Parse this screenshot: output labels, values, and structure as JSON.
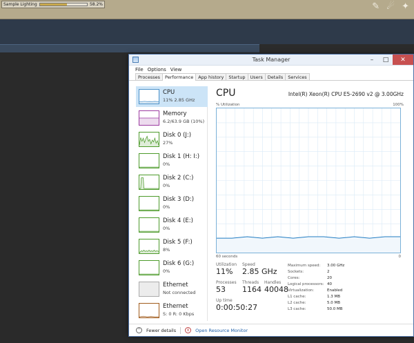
{
  "background": {
    "sample_label": "Sample Lighting",
    "sample_value": "58.2%",
    "sample_fill_fraction": 0.582
  },
  "window": {
    "title": "Task Manager",
    "minimize": "–",
    "maximize": "□",
    "close": "✕"
  },
  "menu": [
    "File",
    "Options",
    "View"
  ],
  "tabs": [
    {
      "label": "Processes"
    },
    {
      "label": "Performance"
    },
    {
      "label": "App history"
    },
    {
      "label": "Startup"
    },
    {
      "label": "Users"
    },
    {
      "label": "Details"
    },
    {
      "label": "Services"
    }
  ],
  "devices": [
    {
      "name": "CPU",
      "value": "11% 2.85 GHz",
      "color": "#4a90c8",
      "selected": true
    },
    {
      "name": "Memory",
      "value": "6.2/63.9 GB (10%)",
      "color": "#9b3aa0"
    },
    {
      "name": "Disk 0 (J:)",
      "value": "27%",
      "color": "#4c9a2a"
    },
    {
      "name": "Disk 1 (H: I:)",
      "value": "0%",
      "color": "#4c9a2a"
    },
    {
      "name": "Disk 2 (C:)",
      "value": "0%",
      "color": "#4c9a2a"
    },
    {
      "name": "Disk 3 (D:)",
      "value": "0%",
      "color": "#4c9a2a"
    },
    {
      "name": "Disk 4 (E:)",
      "value": "0%",
      "color": "#4c9a2a"
    },
    {
      "name": "Disk 5 (F:)",
      "value": "8%",
      "color": "#4c9a2a"
    },
    {
      "name": "Disk 6 (G:)",
      "value": "0%",
      "color": "#4c9a2a"
    },
    {
      "name": "Ethernet",
      "value": "Not connected",
      "color": "#aaaaaa"
    },
    {
      "name": "Ethernet",
      "value": "S: 0 R: 0 Kbps",
      "color": "#a05a1a"
    }
  ],
  "main": {
    "title": "CPU",
    "model": "Intel(R) Xeon(R) CPU E5-2690 v2 @ 3.00GHz",
    "util_label": "% Utilization",
    "util_max": "100%",
    "axis_left": "60 seconds",
    "axis_right": "0",
    "stats": {
      "utilization_label": "Utilization",
      "utilization": "11%",
      "speed_label": "Speed",
      "speed": "2.85 GHz",
      "processes_label": "Processes",
      "processes": "53",
      "threads_label": "Threads",
      "threads": "1164",
      "handles_label": "Handles",
      "handles": "40048",
      "uptime_label": "Up time",
      "uptime": "0:00:50:27"
    },
    "specs": [
      {
        "k": "Maximum speed:",
        "v": "3.00 GHz"
      },
      {
        "k": "Sockets:",
        "v": "2"
      },
      {
        "k": "Cores:",
        "v": "20"
      },
      {
        "k": "Logical processors:",
        "v": "40"
      },
      {
        "k": "Virtualization:",
        "v": "Enabled"
      },
      {
        "k": "L1 cache:",
        "v": "1.3 MB"
      },
      {
        "k": "L2 cache:",
        "v": "5.0 MB"
      },
      {
        "k": "L3 cache:",
        "v": "50.0 MB"
      }
    ]
  },
  "footer": {
    "fewer_details": "Fewer details",
    "open_resource_monitor": "Open Resource Monitor"
  },
  "chart_data": {
    "type": "area",
    "ylim": [
      0,
      100
    ],
    "x": [
      60,
      55,
      50,
      45,
      40,
      35,
      30,
      25,
      20,
      15,
      10,
      5,
      0
    ],
    "series": [
      {
        "values": [
          10,
          10,
          11,
          10,
          11,
          10,
          11,
          11,
          10,
          11,
          10,
          11,
          11
        ]
      }
    ]
  }
}
